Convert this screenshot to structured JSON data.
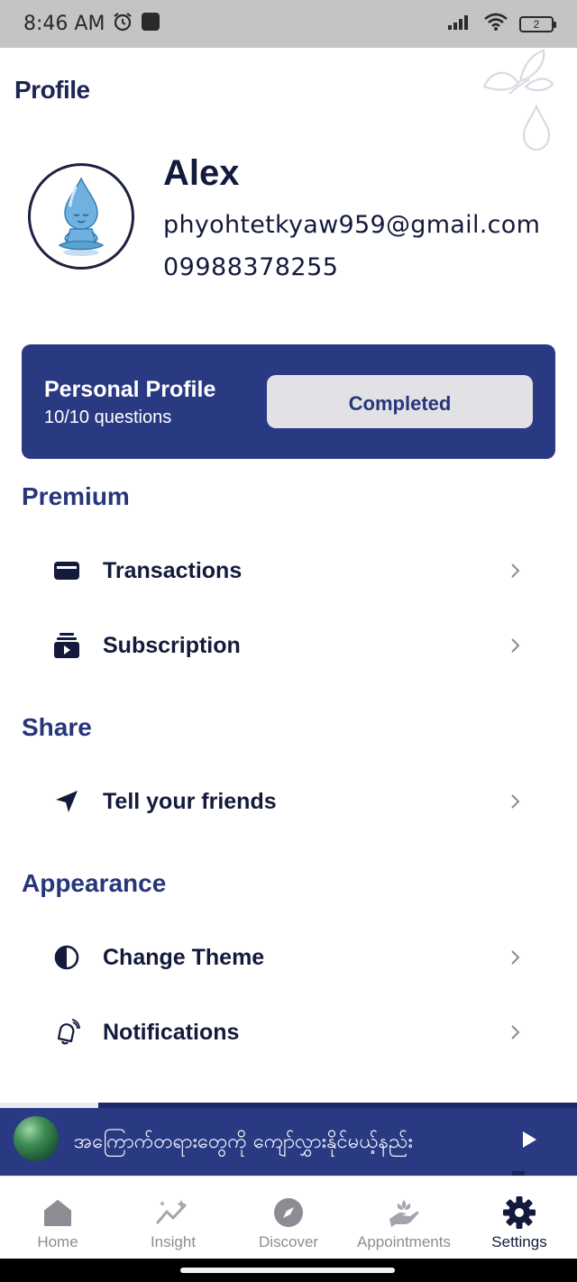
{
  "status_bar": {
    "time": "8:46 AM",
    "battery": "2",
    "icons": [
      "alarm-icon",
      "app-notification-icon",
      "signal-icon",
      "wifi-icon",
      "battery-icon"
    ]
  },
  "page": {
    "title": "Profile"
  },
  "user": {
    "name": "Alex",
    "email": "phyohtetkyaw959@gmail.com",
    "phone": "09988378255"
  },
  "profile_card": {
    "title": "Personal Profile",
    "progress": "10/10 questions",
    "button_label": "Completed"
  },
  "sections": {
    "premium": {
      "title": "Premium",
      "items": [
        {
          "label": "Transactions",
          "icon": "wallet-icon"
        },
        {
          "label": "Subscription",
          "icon": "subscription-icon"
        }
      ]
    },
    "share": {
      "title": "Share",
      "items": [
        {
          "label": "Tell your friends",
          "icon": "send-icon"
        }
      ]
    },
    "appearance": {
      "title": "Appearance",
      "items": [
        {
          "label": "Change Theme",
          "icon": "theme-icon"
        },
        {
          "label": "Notifications",
          "icon": "bell-icon"
        }
      ]
    }
  },
  "player": {
    "title": "အကြောက်တရားတွေကို ကျော်လွှားနိုင်မယ့်နည်း",
    "progress_fraction": 0.17
  },
  "bottom_nav": {
    "active": "Settings",
    "items": [
      {
        "label": "Home",
        "icon": "home-icon"
      },
      {
        "label": "Insight",
        "icon": "insight-icon"
      },
      {
        "label": "Discover",
        "icon": "compass-icon"
      },
      {
        "label": "Appointments",
        "icon": "hands-icon"
      },
      {
        "label": "Settings",
        "icon": "gear-icon"
      }
    ]
  },
  "colors": {
    "primary": "#293a82",
    "section_title": "#26367a",
    "text_dark": "#141a3b",
    "button_bg": "#e2e2e6",
    "status_bar_bg": "#c4c4c4",
    "nav_inactive": "#8c8c94"
  }
}
